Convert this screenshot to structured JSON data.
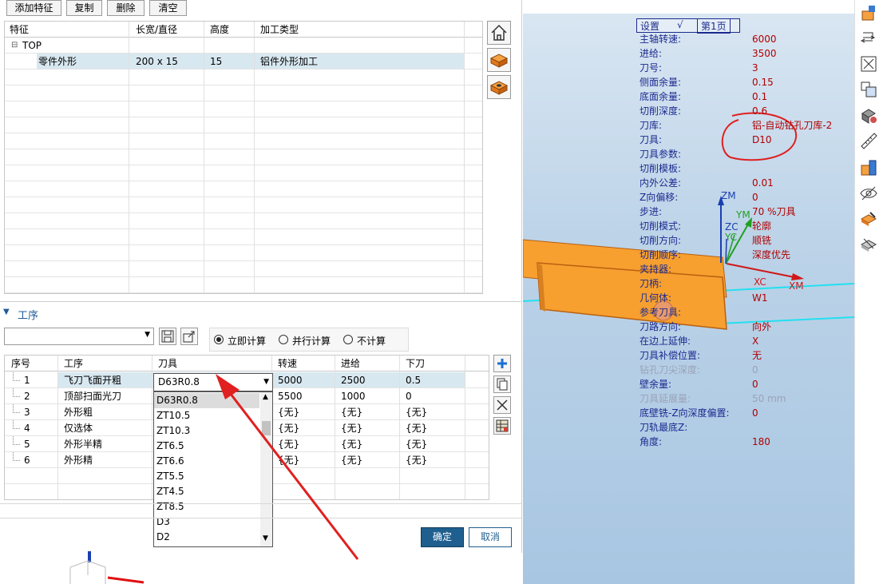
{
  "toolbar": {
    "add_feature": "添加特征",
    "copy": "复制",
    "delete": "删除",
    "clear": "清空"
  },
  "feature_table": {
    "headers": [
      "特征",
      "长宽/直径",
      "高度",
      "加工类型"
    ],
    "tree_root": "TOP",
    "tree_toggle": "⊟",
    "row": {
      "name": "零件外形",
      "size": "200 x 15",
      "height": "15",
      "type": "铝件外形加工"
    }
  },
  "process_section": {
    "title": "工序",
    "calc_options": [
      "立即计算",
      "并行计算",
      "不计算"
    ],
    "selected_calc": "立即计算",
    "headers": [
      "序号",
      "工序",
      "刀具",
      "转速",
      "进给",
      "下刀"
    ],
    "rows": [
      {
        "no": "1",
        "name": "飞刀飞面开粗",
        "tool": "D63R0.8",
        "speed": "5000",
        "feed": "2500",
        "down": "0.5"
      },
      {
        "no": "2",
        "name": "顶部扫面光刀",
        "tool": "",
        "speed": "5500",
        "feed": "1000",
        "down": "0"
      },
      {
        "no": "3",
        "name": "外形粗",
        "tool": "",
        "speed": "{无}",
        "feed": "{无}",
        "down": "{无}"
      },
      {
        "no": "4",
        "name": "仅选体",
        "tool": "",
        "speed": "{无}",
        "feed": "{无}",
        "down": "{无}"
      },
      {
        "no": "5",
        "name": "外形半精",
        "tool": "",
        "speed": "{无}",
        "feed": "{无}",
        "down": "{无}"
      },
      {
        "no": "6",
        "name": "外形精",
        "tool": "",
        "speed": "{无}",
        "feed": "{无}",
        "down": "{无}"
      }
    ],
    "tool_dropdown": {
      "selected": "D63R0.8",
      "options": [
        "D63R0.8",
        "ZT10.5",
        "ZT10.3",
        "ZT6.5",
        "ZT6.6",
        "ZT5.5",
        "ZT4.5",
        "ZT8.5",
        "D3",
        "D2"
      ]
    }
  },
  "dialog_buttons": {
    "ok": "确定",
    "cancel": "取消"
  },
  "viewport": {
    "tabs": [
      "设置",
      "√",
      "第1页"
    ],
    "params": [
      {
        "label": "主轴转速:",
        "value": "6000"
      },
      {
        "label": "进给:",
        "value": "3500"
      },
      {
        "label": "刀号:",
        "value": "3"
      },
      {
        "label": "侧面余量:",
        "value": "0.15"
      },
      {
        "label": "底面余量:",
        "value": "0.1"
      },
      {
        "label": "切削深度:",
        "value": "0.6"
      },
      {
        "label": "刀库:",
        "value": "铝-自动钻孔刀库-2"
      },
      {
        "label": "刀具:",
        "value": "D10"
      },
      {
        "label": "刀具参数:",
        "value": ""
      },
      {
        "label": "切削模板:",
        "value": ""
      },
      {
        "label": "内外公差:",
        "value": "0.01"
      },
      {
        "label": "Z向偏移:",
        "value": "0"
      },
      {
        "label": "步进:",
        "value": "70  %刀具"
      },
      {
        "label": "切削模式:",
        "value": "轮廓"
      },
      {
        "label": "切削方向:",
        "value": "顺铣"
      },
      {
        "label": "切削顺序:",
        "value": "深度优先"
      },
      {
        "label": "夹持器:",
        "value": ""
      },
      {
        "label": "刀柄:",
        "value": ""
      },
      {
        "label": "几何体:",
        "value": "W1"
      },
      {
        "label": "参考刀具:",
        "value": ""
      },
      {
        "label": "刀路方向:",
        "value": "向外"
      },
      {
        "label": "在边上延伸:",
        "value": "X"
      },
      {
        "label": "刀具补偿位置:",
        "value": "无"
      },
      {
        "label": "钻孔刀尖深度:",
        "value": "0"
      },
      {
        "label": "壁余量:",
        "value": "0"
      },
      {
        "label": "刀具延展量:",
        "value": "50   mm"
      },
      {
        "label": "底壁铣-Z向深度偏置:",
        "value": "0"
      },
      {
        "label": "刀轨最底Z:",
        "value": ""
      },
      {
        "label": "角度:",
        "value": "180"
      }
    ],
    "axes": {
      "zm": "ZM",
      "ym": "YM",
      "zc": "ZC",
      "yc": "YC",
      "xc": "XC",
      "xm": "XM"
    },
    "colors": {
      "part": "#f7a030",
      "param_label": "#1c2a8f",
      "param_value": "#b00000",
      "annotation": "#e02020",
      "cyan_line": "#22e0f0"
    }
  }
}
